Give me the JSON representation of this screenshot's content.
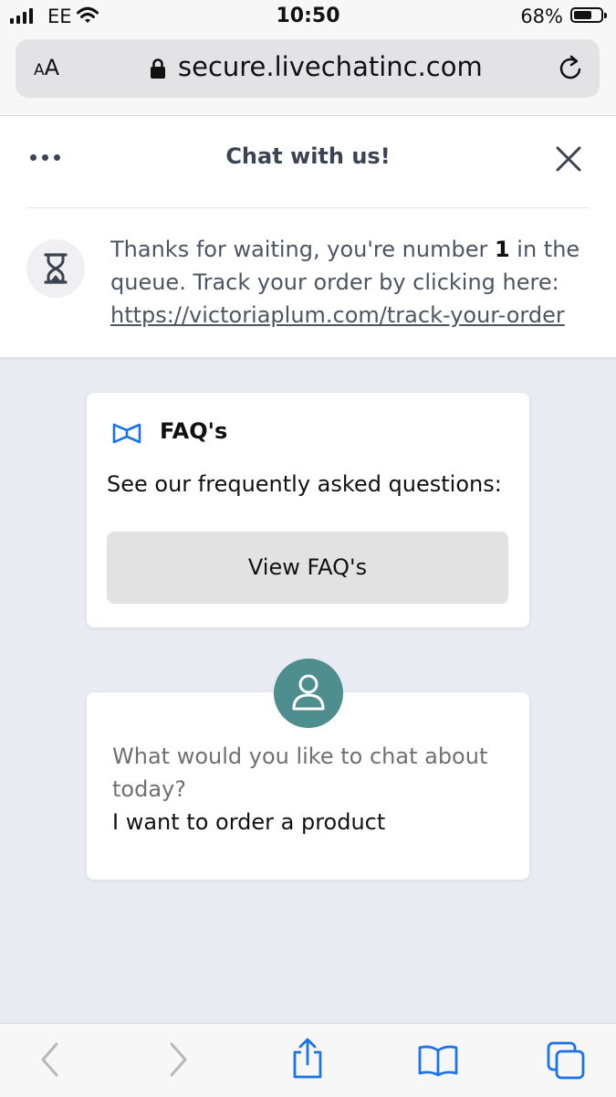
{
  "status": {
    "carrier": "EE",
    "time": "10:50",
    "battery_percent": "68%",
    "battery_level": 0.68
  },
  "browser": {
    "text_size_label_small": "A",
    "text_size_label_large": "A",
    "url": "secure.livechatinc.com"
  },
  "chat": {
    "title": "Chat with us!",
    "queue": {
      "text_before": "Thanks for waiting, you're number ",
      "position": "1",
      "text_after": " in the queue. Track your order by clicking here: ",
      "link": "https://victoriaplum.com/track-your-order"
    },
    "faq": {
      "title": "FAQ's",
      "description": "See our frequently asked questions:",
      "button_label": "View FAQ's"
    },
    "topic": {
      "question": "What would you like to chat about today?",
      "answer": "I want to order a product"
    }
  },
  "colors": {
    "accent_blue": "#1a73e8",
    "avatar_teal": "#4e8e8e",
    "background": "#e9ebf3"
  },
  "icons": [
    "ellipsis-icon",
    "close-icon",
    "hourglass-icon",
    "book-icon",
    "user-icon",
    "back-icon",
    "forward-icon",
    "share-icon",
    "bookmarks-icon",
    "tabs-icon",
    "lock-icon",
    "reload-icon",
    "wifi-icon"
  ]
}
